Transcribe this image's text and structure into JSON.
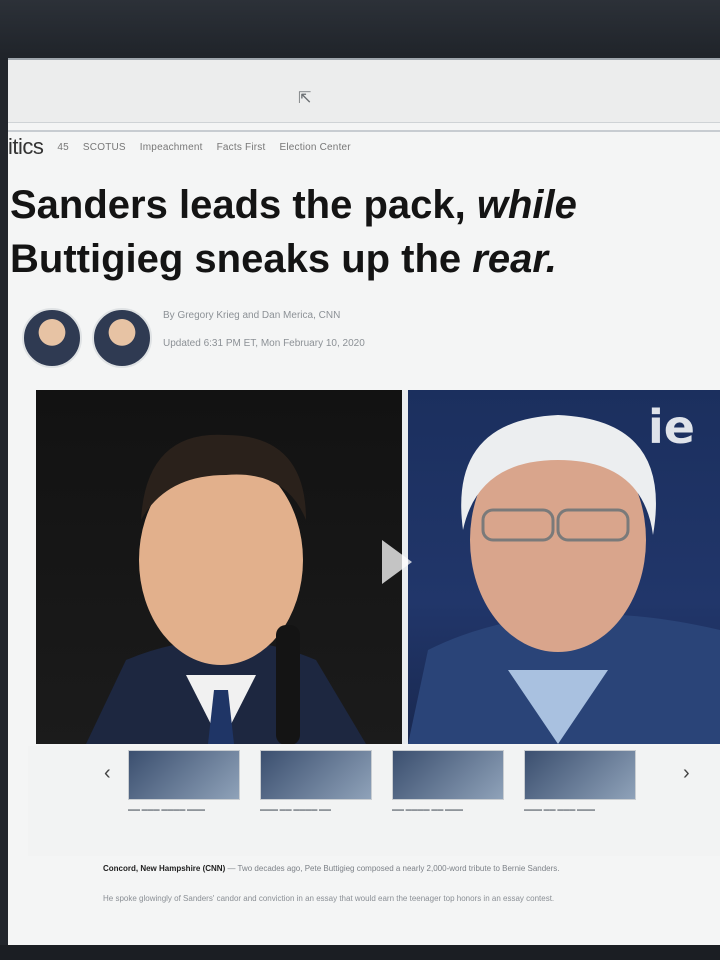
{
  "nav": {
    "section": "itics",
    "links": [
      "45",
      "SCOTUS",
      "Impeachment",
      "Facts First",
      "Election Center"
    ]
  },
  "headline": {
    "line1_a": "Sanders leads the pack, ",
    "line1_b": "while",
    "line2_a": "Buttigieg sneaks up the ",
    "line2_b": "rear."
  },
  "article": {
    "byline": "By Gregory Krieg and Dan Merica, CNN",
    "updated": "Updated 6:31 PM ET, Mon February 10, 2020",
    "sign_text": "ie",
    "dateline": "Concord, New Hampshire (CNN)",
    "lead": " — Two decades ago, Pete Buttigieg composed a nearly 2,000-word tribute to Bernie Sanders.",
    "para2": "He spoke glowingly of Sanders' candor and conviction in an essay that would earn the teenager top honors in an essay contest."
  },
  "carousel": {
    "prev": "‹",
    "next": "›"
  }
}
